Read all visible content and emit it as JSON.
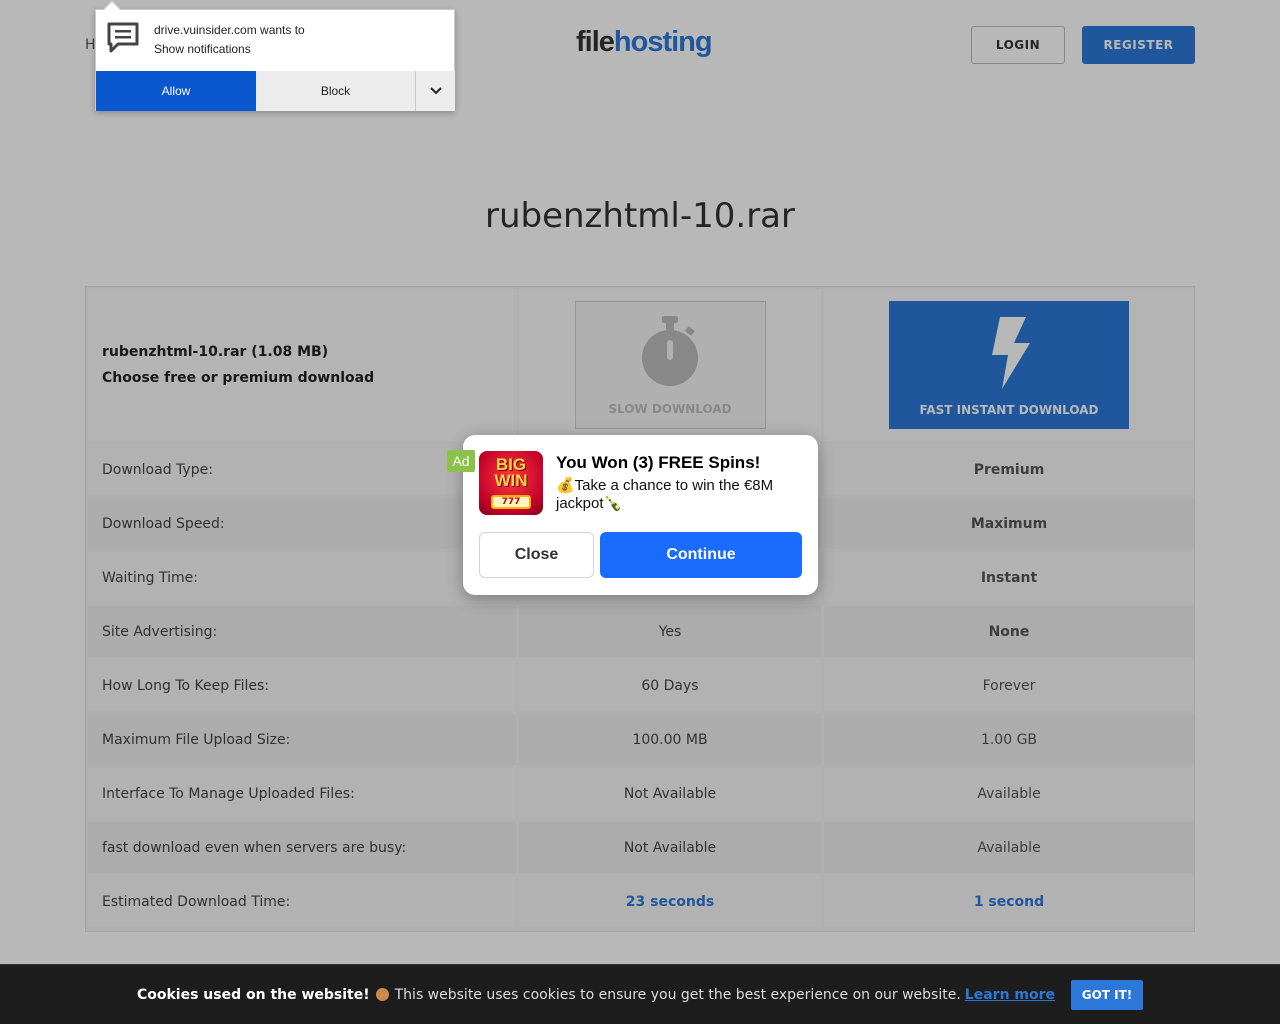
{
  "header": {
    "home_partial": "H",
    "logo_part1": "file",
    "logo_part2": "hosting",
    "login_label": "LOGIN",
    "register_label": "REGISTER"
  },
  "file_title": "rubenzhtml-10.rar",
  "download_box": {
    "file_line": "rubenzhtml-10.rar (1.08 MB)",
    "choose_line": "Choose free or premium download",
    "slow_label": "SLOW DOWNLOAD",
    "fast_label": "FAST INSTANT DOWNLOAD"
  },
  "table": {
    "rows": [
      {
        "label": "Download Type:",
        "free": "",
        "premium": "Premium"
      },
      {
        "label": "Download Speed:",
        "free": "",
        "premium": "Maximum"
      },
      {
        "label": "Waiting Time:",
        "free": "",
        "premium": "Instant"
      },
      {
        "label": "Site Advertising:",
        "free": "Yes",
        "premium": "None"
      },
      {
        "label": "How Long To Keep Files:",
        "free": "60 Days",
        "premium": "Forever"
      },
      {
        "label": "Maximum File Upload Size:",
        "free": "100.00 MB",
        "premium": "1.00 GB"
      },
      {
        "label": "Interface To Manage Uploaded Files:",
        "free": "Not Available",
        "premium": "Available"
      },
      {
        "label": "fast download even when servers are busy:",
        "free": "Not Available",
        "premium": "Available"
      },
      {
        "label": "Estimated Download Time:",
        "free": "23 seconds",
        "premium": "1 second"
      }
    ]
  },
  "notification": {
    "line1": "drive.vuinsider.com wants to",
    "line2": "Show notifications",
    "allow_label": "Allow",
    "block_label": "Block"
  },
  "ad": {
    "tag": "Ad",
    "image_text_line1": "BIG",
    "image_text_line2": "WIN",
    "image_slots": "777",
    "title": "You Won (3) FREE Spins!",
    "desc": "💰Take a chance to win the €8M jackpot🍾",
    "close_label": "Close",
    "continue_label": "Continue"
  },
  "cookie": {
    "title": "Cookies used on the website!",
    "text": "This website uses cookies to ensure you get the best experience on our website.",
    "learn_more": "Learn more",
    "got_it": "GOT IT!"
  },
  "colors": {
    "brand_blue": "#2b78d8",
    "allow_blue": "#0b57d0",
    "ad_continue": "#1a6bff",
    "ad_tag_green": "#8bc34a"
  }
}
